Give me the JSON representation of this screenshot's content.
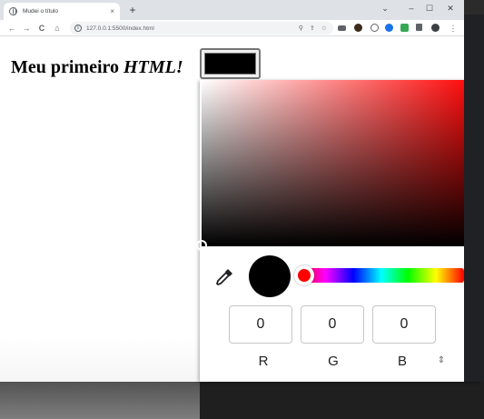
{
  "browser": {
    "tab_title": "Mudei o título",
    "tab_close": "×",
    "new_tab": "+",
    "window_controls": {
      "collapse": "⌄",
      "minimize": "–",
      "maximize": "☐",
      "close": "✕"
    },
    "nav": {
      "back": "←",
      "forward": "→",
      "reload": "C",
      "home": "⌂"
    },
    "url": "127.0.0.1:5500/index.html",
    "omnibox_icons": [
      "zoom-icon",
      "share-icon",
      "star-icon"
    ],
    "menu": "⋮"
  },
  "page": {
    "heading_plain": "Meu primeiro ",
    "heading_italic": "HTML!",
    "color_value": "#000000"
  },
  "picker": {
    "hue_color": "#ff0000",
    "channels": [
      {
        "label": "R",
        "value": "0"
      },
      {
        "label": "G",
        "value": "0"
      },
      {
        "label": "B",
        "value": "0"
      }
    ],
    "format_toggle": "⇕"
  }
}
